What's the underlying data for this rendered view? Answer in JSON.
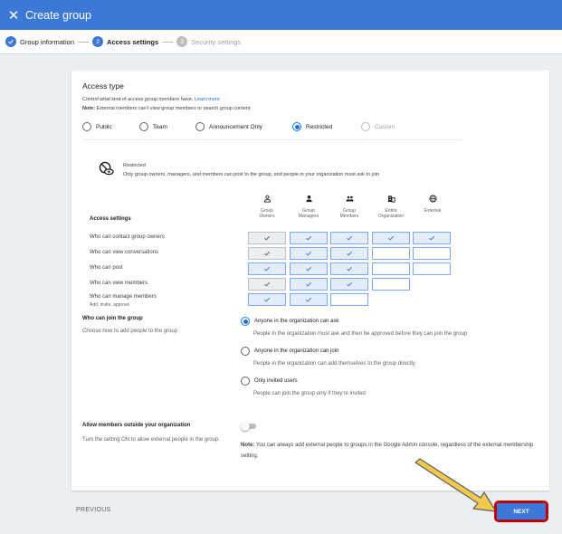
{
  "header": {
    "title": "Create group"
  },
  "stepper": {
    "steps": [
      {
        "label": "Group information",
        "num": ""
      },
      {
        "label": "Access settings",
        "num": "2"
      },
      {
        "label": "Security settings",
        "num": "3"
      }
    ]
  },
  "access_type": {
    "title": "Access type",
    "description": "Control what kind of access group members have.",
    "learn_more": "Learn more",
    "note_label": "Note:",
    "note_text": "External members can't view group members or search group content",
    "options": [
      {
        "label": "Public"
      },
      {
        "label": "Team"
      },
      {
        "label": "Announcement Only"
      },
      {
        "label": "Restricted",
        "selected": true
      },
      {
        "label": "Custom",
        "disabled": true
      }
    ]
  },
  "restricted": {
    "title": "Restricted",
    "description": "Only group owners, managers, and members can post to the group, and people in your organization must ask to join"
  },
  "access_settings": {
    "label": "Access settings",
    "columns": [
      {
        "line1": "Group",
        "line2": "Owners",
        "icon": "person-outline-icon"
      },
      {
        "line1": "Group",
        "line2": "Managers",
        "icon": "person-icon"
      },
      {
        "line1": "Group",
        "line2": "Members",
        "icon": "people-icon"
      },
      {
        "line1": "Entire",
        "line2": "Organization",
        "icon": "business-icon"
      },
      {
        "line1": "External",
        "line2": "",
        "icon": "globe-icon"
      }
    ],
    "rows": [
      {
        "label": "Who can contact group owners",
        "sub": "",
        "cells": [
          "grey",
          "on",
          "on",
          "on",
          "on"
        ]
      },
      {
        "label": "Who can view conversations",
        "sub": "",
        "cells": [
          "grey",
          "on",
          "on",
          "off",
          "off"
        ]
      },
      {
        "label": "Who can post",
        "sub": "",
        "cells": [
          "on",
          "on",
          "on",
          "off",
          "off"
        ]
      },
      {
        "label": "Who can view members",
        "sub": "",
        "cells": [
          "grey",
          "on",
          "on",
          "off",
          "none"
        ]
      },
      {
        "label": "Who can manage members",
        "sub": "Add, invite, approve",
        "cells": [
          "on",
          "on",
          "off",
          "none",
          "none"
        ]
      }
    ]
  },
  "join": {
    "title": "Who can join the group",
    "description": "Choose how to add people to the group",
    "options": [
      {
        "label": "Anyone in the organization can ask",
        "desc": "People in the organization must ask and then be approved before they can join the group",
        "selected": true
      },
      {
        "label": "Anyone in the organization can join",
        "desc": "People in the organization can add themselves to the group directly",
        "selected": false
      },
      {
        "label": "Only invited users",
        "desc": "People can join the group only if they're invited",
        "selected": false
      }
    ]
  },
  "outside": {
    "title": "Allow members outside your organization",
    "description": "Turn the setting ON to allow external people in the group.",
    "toggle_on": false,
    "note_label": "Note:",
    "note_text": "You can always add external people to groups in the Google Admin console, regardless of the external membership setting."
  },
  "footer": {
    "previous": "PREVIOUS",
    "next": "NEXT"
  },
  "colors": {
    "primary": "#3c78d8",
    "highlight": "#c00000",
    "arrow": "#f2c94c"
  }
}
